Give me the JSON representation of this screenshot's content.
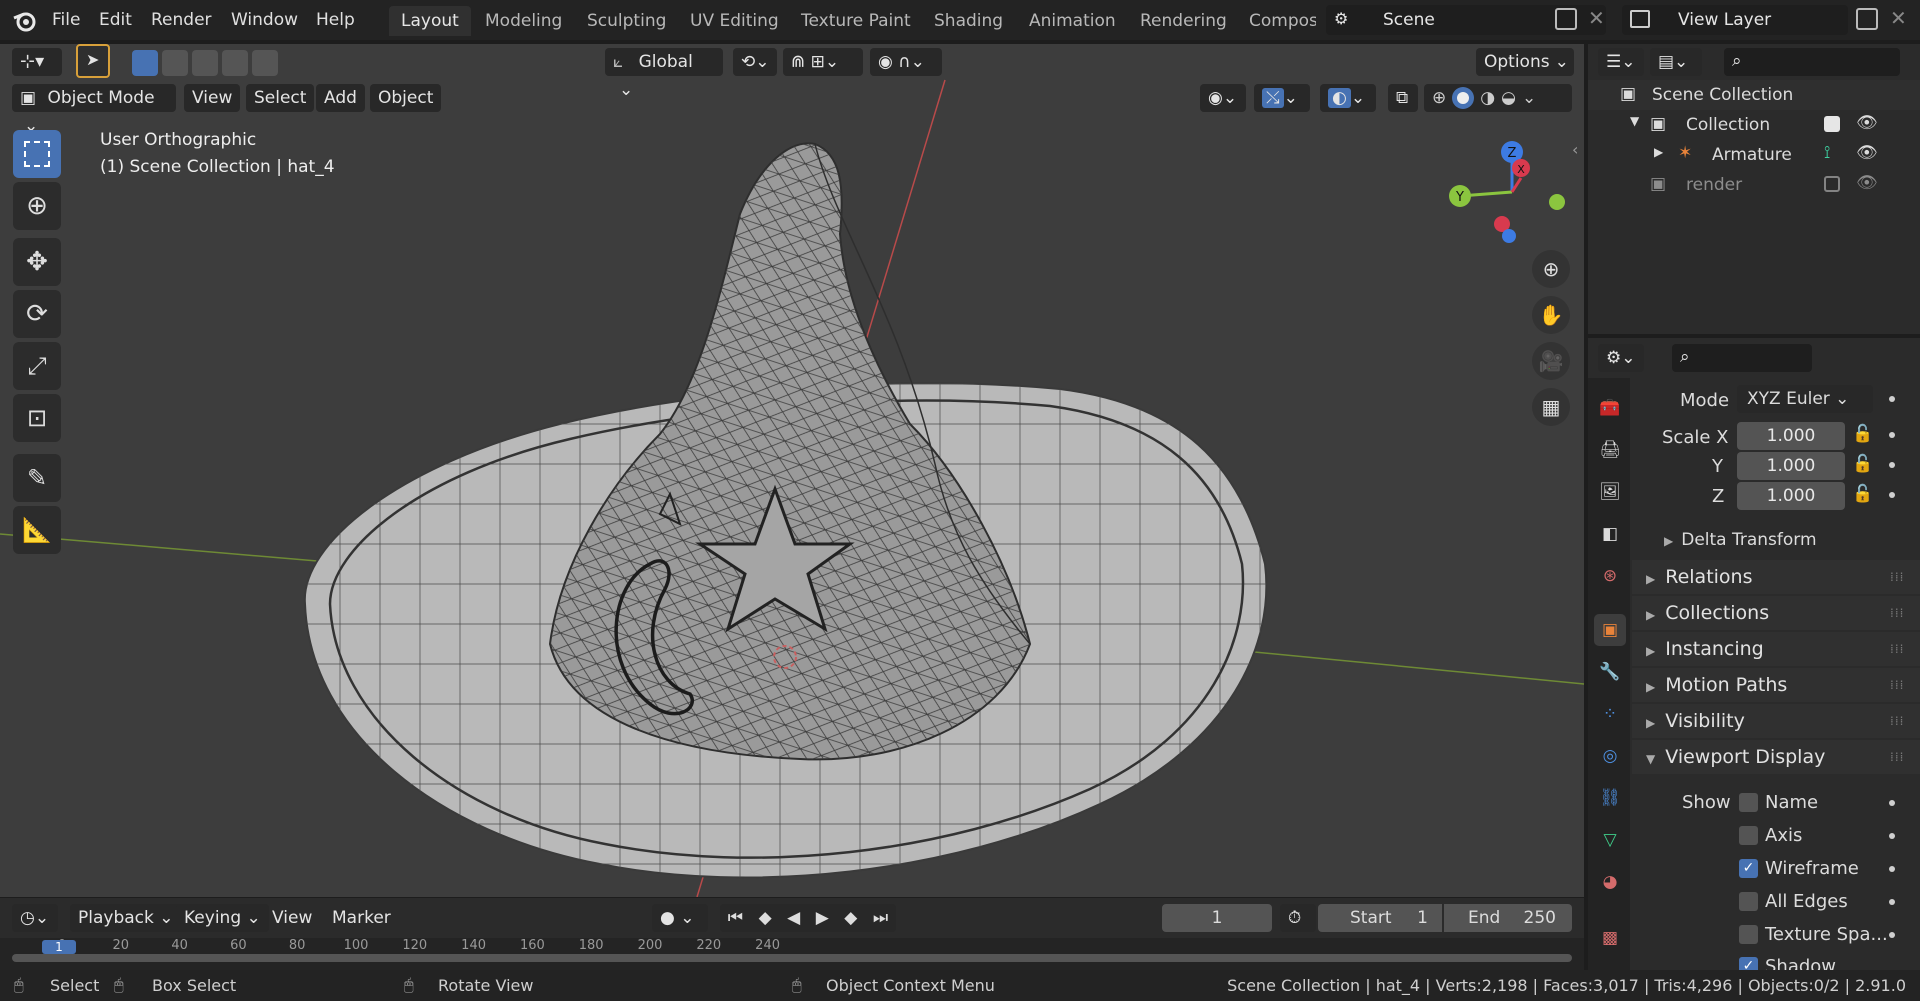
{
  "menubar": {
    "items": [
      "File",
      "Edit",
      "Render",
      "Window",
      "Help"
    ]
  },
  "workspaces": [
    "Layout",
    "Modeling",
    "Sculpting",
    "UV Editing",
    "Texture Paint",
    "Shading",
    "Animation",
    "Rendering",
    "Compos"
  ],
  "scene": {
    "name": "Scene"
  },
  "view_layer": {
    "name": "View Layer"
  },
  "viewport_header": {
    "transform_orientation": "Global",
    "options_label": "Options",
    "mode": "Object Mode",
    "menus": [
      "View",
      "Select",
      "Add",
      "Object"
    ]
  },
  "viewport": {
    "view_name": "User Orthographic",
    "context": "(1) Scene Collection | hat_4"
  },
  "gizmo": {
    "z": "Z",
    "y": "Y",
    "x": "X"
  },
  "outliner": {
    "items": [
      {
        "label": "Scene Collection"
      },
      {
        "label": "Collection",
        "checked": true
      },
      {
        "label": "Armature"
      },
      {
        "label": "render",
        "checked": false
      }
    ]
  },
  "properties": {
    "rotation_mode_label": "Mode",
    "rotation_mode": "XYZ Euler",
    "scale": [
      {
        "label": "Scale X",
        "value": "1.000"
      },
      {
        "label": "Y",
        "value": "1.000"
      },
      {
        "label": "Z",
        "value": "1.000"
      }
    ],
    "delta_transform": "Delta Transform",
    "panels": [
      "Relations",
      "Collections",
      "Instancing",
      "Motion Paths",
      "Visibility",
      "Viewport Display"
    ],
    "show_label": "Show",
    "show_items": [
      {
        "label": "Name",
        "checked": false
      },
      {
        "label": "Axis",
        "checked": false
      },
      {
        "label": "Wireframe",
        "checked": true
      },
      {
        "label": "All Edges",
        "checked": false
      },
      {
        "label": "Texture Spa...",
        "checked": false
      },
      {
        "label": "Shadow",
        "checked": true
      }
    ]
  },
  "timeline": {
    "menus": [
      "Playback",
      "Keying",
      "View",
      "Marker"
    ],
    "current_frame": "1",
    "start_label": "Start",
    "start": "1",
    "end_label": "End",
    "end": "250",
    "ticks": [
      "0",
      "20",
      "40",
      "60",
      "80",
      "100",
      "120",
      "140",
      "160",
      "180",
      "200",
      "220",
      "240"
    ],
    "cursor_frame": "1"
  },
  "statusbar": {
    "select": "Select",
    "box_select": "Box Select",
    "rotate_view": "Rotate View",
    "context_menu": "Object Context Menu",
    "stats": "Scene Collection | hat_4 | Verts:2,198 | Faces:3,017 | Tris:4,296 | Objects:0/2 | 2.91.0"
  },
  "colors": {
    "accent": "#4772b3",
    "viewport_bg": "#3d3d3d",
    "panel_bg": "#2b2b2b",
    "x_axis": "#d83a4e",
    "y_axis": "#8bc53f",
    "z_axis": "#3d7be3"
  }
}
